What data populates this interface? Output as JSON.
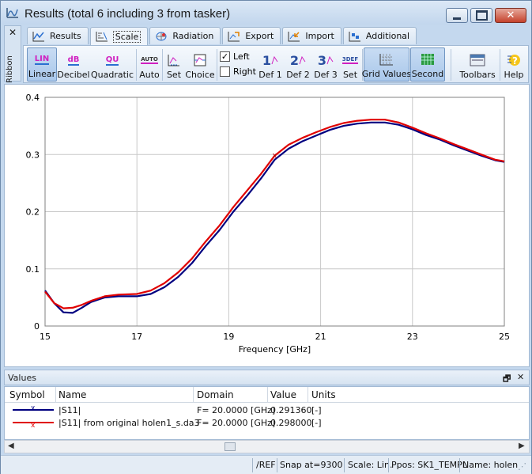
{
  "window": {
    "title": "Results (total 6 including 3 from tasker)",
    "close_symbol": "✕"
  },
  "ribbon": {
    "label": "Ribbon",
    "close_symbol": "✕"
  },
  "tabs": [
    {
      "label": "Results",
      "icon": "results-chart-icon"
    },
    {
      "label": "Scale",
      "icon": "scale-icon"
    },
    {
      "label": "Radiation",
      "icon": "radiation-icon"
    },
    {
      "label": "Export",
      "icon": "export-icon"
    },
    {
      "label": "Import",
      "icon": "import-icon"
    },
    {
      "label": "Additional",
      "icon": "additional-icon"
    }
  ],
  "toolbar": {
    "linear": {
      "label": "Linear",
      "icon_text": "LIN"
    },
    "decibel": {
      "label": "Decibel",
      "icon_text": "dB"
    },
    "quadratic": {
      "label": "Quadratic",
      "icon_text": "QU"
    },
    "auto": {
      "label": "Auto",
      "icon_text": "AUTO"
    },
    "set": {
      "label": "Set"
    },
    "choice": {
      "label": "Choice"
    },
    "left": {
      "label": "Left",
      "checked": true
    },
    "right": {
      "label": "Right",
      "checked": false
    },
    "def1": {
      "label": "Def 1",
      "icon_text": "1"
    },
    "def2": {
      "label": "Def 2",
      "icon_text": "2"
    },
    "def3": {
      "label": "Def 3",
      "icon_text": "3"
    },
    "set2": {
      "label": "Set",
      "icon_text": "3DEF"
    },
    "grid_values": {
      "label": "Grid Values"
    },
    "second": {
      "label": "Second"
    },
    "toolbars": {
      "label": "Toolbars"
    },
    "help": {
      "label": "Help"
    }
  },
  "chart_data": {
    "type": "line",
    "xlabel": "Frequency [GHz]",
    "ylabel": "",
    "xlim": [
      15,
      25
    ],
    "ylim": [
      0,
      0.4
    ],
    "x_ticks": [
      "15",
      "17",
      "19",
      "21",
      "23",
      "25"
    ],
    "y_ticks": [
      "0",
      "0.1",
      "0.2",
      "0.3",
      "0.4"
    ],
    "grid": true,
    "series": [
      {
        "name": "|S11|",
        "color": "#000080",
        "x": [
          15.0,
          15.2,
          15.4,
          15.6,
          15.8,
          16.0,
          16.3,
          16.6,
          17.0,
          17.3,
          17.6,
          17.9,
          18.2,
          18.5,
          18.8,
          19.1,
          19.4,
          19.7,
          20.0,
          20.3,
          20.6,
          20.9,
          21.2,
          21.5,
          21.8,
          22.1,
          22.4,
          22.7,
          23.0,
          23.3,
          23.6,
          23.9,
          24.2,
          24.5,
          24.8,
          25.0
        ],
        "y": [
          0.062,
          0.04,
          0.024,
          0.023,
          0.032,
          0.042,
          0.05,
          0.052,
          0.052,
          0.056,
          0.068,
          0.086,
          0.11,
          0.14,
          0.168,
          0.2,
          0.228,
          0.258,
          0.291,
          0.31,
          0.323,
          0.333,
          0.343,
          0.35,
          0.354,
          0.356,
          0.356,
          0.352,
          0.344,
          0.334,
          0.326,
          0.316,
          0.307,
          0.298,
          0.29,
          0.287
        ]
      },
      {
        "name": "|S11|  from original holen1_s.da3",
        "color": "#e00000",
        "x": [
          15.0,
          15.2,
          15.4,
          15.6,
          15.8,
          16.0,
          16.3,
          16.6,
          17.0,
          17.3,
          17.6,
          17.9,
          18.2,
          18.5,
          18.8,
          19.1,
          19.4,
          19.7,
          20.0,
          20.3,
          20.6,
          20.9,
          21.2,
          21.5,
          21.8,
          22.1,
          22.4,
          22.7,
          23.0,
          23.3,
          23.6,
          23.9,
          24.2,
          24.5,
          24.8,
          25.0
        ],
        "y": [
          0.06,
          0.04,
          0.031,
          0.032,
          0.037,
          0.044,
          0.052,
          0.055,
          0.056,
          0.062,
          0.075,
          0.094,
          0.118,
          0.148,
          0.176,
          0.208,
          0.237,
          0.266,
          0.298,
          0.317,
          0.329,
          0.339,
          0.348,
          0.355,
          0.359,
          0.361,
          0.361,
          0.356,
          0.347,
          0.337,
          0.328,
          0.318,
          0.309,
          0.3,
          0.291,
          0.288
        ]
      }
    ],
    "marker": {
      "x": 20.0,
      "label": "x"
    }
  },
  "values_panel": {
    "title": "Values",
    "pin_symbol": "🗗",
    "close_symbol": "✕",
    "columns": [
      "Symbol",
      "Name",
      "Domain",
      "Value",
      "Units"
    ],
    "rows": [
      {
        "symbol_color": "#000080",
        "symbol_mark": "v",
        "name": "|S11|",
        "domain": "F= 20.0000 [GHz]",
        "value": "0.291360",
        "units": "[-]"
      },
      {
        "symbol_color": "#e00000",
        "symbol_mark": "x",
        "name": "|S11|  from original holen1_s.da3",
        "domain": "F= 20.0000 [GHz]",
        "value": "0.298000",
        "units": "[-]"
      }
    ]
  },
  "statusbar": {
    "ref": "/REF",
    "snap": "Snap at=9300",
    "scale": "Scale: Lin.",
    "ppos": "Ppos: SK1_TEMPL",
    "name": "Name: holen"
  }
}
